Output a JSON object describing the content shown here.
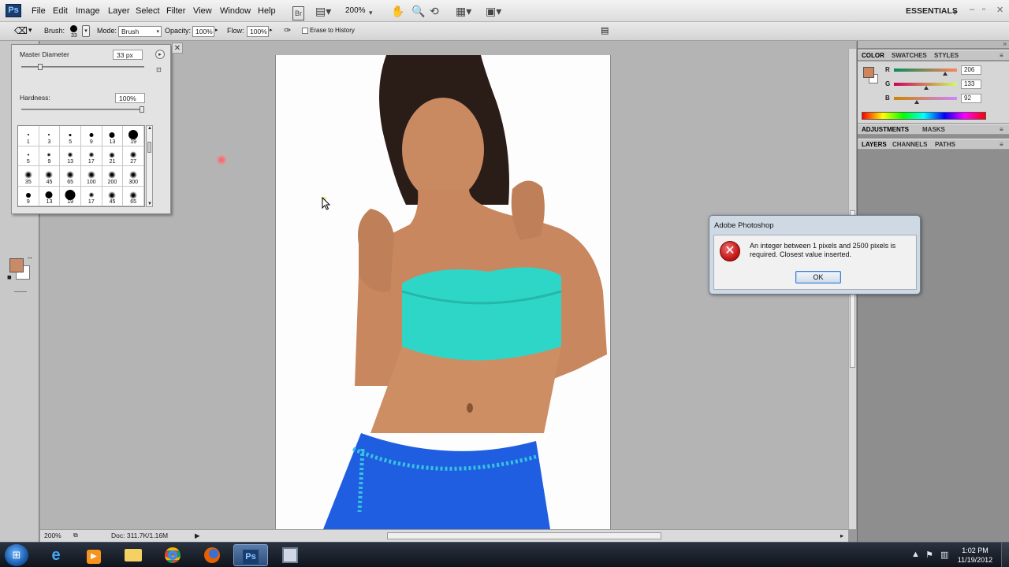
{
  "app": {
    "logo_text": "Ps",
    "menu": [
      "File",
      "Edit",
      "Image",
      "Layer",
      "Select",
      "Filter",
      "View",
      "Window",
      "Help"
    ],
    "br_button": "Br",
    "zoom_value": "200%",
    "workspace": "ESSENTIALS",
    "window_controls": [
      "–",
      "▫",
      "✕"
    ]
  },
  "options_bar": {
    "brush_label": "Brush:",
    "brush_size": "33",
    "mode_label": "Mode:",
    "mode_value": "Brush",
    "opacity_label": "Opacity:",
    "opacity_value": "100%",
    "flow_label": "Flow:",
    "flow_value": "100%",
    "erase_history_label": "Erase to History"
  },
  "brush_picker": {
    "master_diameter_label": "Master Diameter",
    "master_diameter_value": "33 px",
    "hardness_label": "Hardness:",
    "hardness_value": "100%",
    "presets": [
      {
        "size": "1",
        "soft": false
      },
      {
        "size": "3",
        "soft": false
      },
      {
        "size": "5",
        "soft": false
      },
      {
        "size": "9",
        "soft": false
      },
      {
        "size": "13",
        "soft": false
      },
      {
        "size": "19",
        "soft": false
      },
      {
        "size": "5",
        "soft": true
      },
      {
        "size": "9",
        "soft": true
      },
      {
        "size": "13",
        "soft": true
      },
      {
        "size": "17",
        "soft": true
      },
      {
        "size": "21",
        "soft": true
      },
      {
        "size": "27",
        "soft": true
      },
      {
        "size": "35",
        "soft": true
      },
      {
        "size": "45",
        "soft": true
      },
      {
        "size": "65",
        "soft": true
      },
      {
        "size": "100",
        "soft": true
      },
      {
        "size": "200",
        "soft": true
      },
      {
        "size": "300",
        "soft": true
      },
      {
        "size": "9",
        "soft": false
      },
      {
        "size": "13",
        "soft": false
      },
      {
        "size": "19",
        "soft": false
      },
      {
        "size": "17",
        "soft": true
      },
      {
        "size": "45",
        "soft": true
      },
      {
        "size": "65",
        "soft": true
      }
    ]
  },
  "status": {
    "zoom": "200%",
    "doc_info": "Doc: 311.7K/1.16M"
  },
  "panels": {
    "color_tabs": [
      "COLOR",
      "SWATCHES",
      "STYLES"
    ],
    "adjust_tabs": [
      "ADJUSTMENTS",
      "MASKS"
    ],
    "layer_tabs": [
      "LAYERS",
      "CHANNELS",
      "PATHS"
    ],
    "rgb": [
      {
        "label": "R",
        "value": "206"
      },
      {
        "label": "G",
        "value": "133"
      },
      {
        "label": "B",
        "value": "92"
      }
    ]
  },
  "dialog": {
    "title": "Adobe Photoshop",
    "message": "An integer between 1 pixels and 2500 pixels is required.  Closest value inserted.",
    "ok_label": "OK"
  },
  "taskbar": {
    "time": "1:02 PM",
    "date": "11/19/2012"
  },
  "colors": {
    "foreground": "#ce855c",
    "top_color": "#2ed6c8",
    "skirt_color": "#1f5ee0"
  }
}
